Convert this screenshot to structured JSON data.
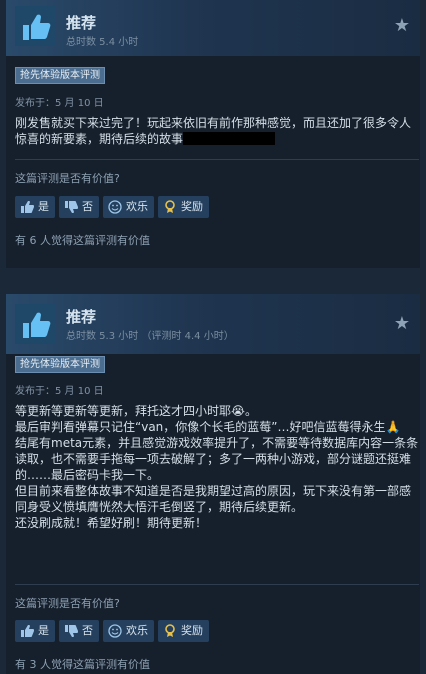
{
  "reviews": [
    {
      "verdict": "推荐",
      "hours": "总时数 5.4 小时",
      "tag": "抢先体验版本评测",
      "posted": "发布于：5 月 10 日",
      "body": [
        "刚发售就买下来过完了！玩起来依旧有前作那种感觉，而且还加了很多令人惊喜的新要素，期待后续的故事"
      ],
      "helpful_question": "这篇评测是否有价值?",
      "buttons": {
        "yes": "是",
        "no": "否",
        "funny": "欢乐",
        "award": "奖励"
      },
      "found_helpful": "有 6 人觉得这篇评测有价值"
    },
    {
      "verdict": "推荐",
      "hours": "总时数 5.3 小时  （评测时 4.4 小时）",
      "tag": "抢先体验版本评测",
      "posted": "发布于：5 月 10 日",
      "body": [
        "等更新等更新等更新，拜托这才四小时耶😭。",
        "最后审判看弹幕只记住“van，你像个长毛的蓝莓”…好吧信蓝莓得永生🙏",
        "结尾有meta元素，并且感觉游戏效率提升了，不需要等待数据库内容一条条读取，也不需要手拖每一项去破解了；多了一两种小游戏，部分谜题还挺难的……最后密码卡我一下。",
        "但目前来看整体故事不知道是否是我期望过高的原因，玩下来没有第一部感同身受义愤填膺恍然大悟汗毛倒竖了，期待后续更新。",
        "",
        "还没刷成就！希望好刷！期待更新！"
      ],
      "helpful_question": "这篇评测是否有价值?",
      "buttons": {
        "yes": "是",
        "no": "否",
        "funny": "欢乐",
        "award": "奖励"
      },
      "found_helpful": "有 3 人觉得这篇评测有价值"
    }
  ],
  "colors": {
    "background": "#1b2838",
    "card": "#16202d",
    "button": "#24405e",
    "tag": "#4b6d8f"
  }
}
